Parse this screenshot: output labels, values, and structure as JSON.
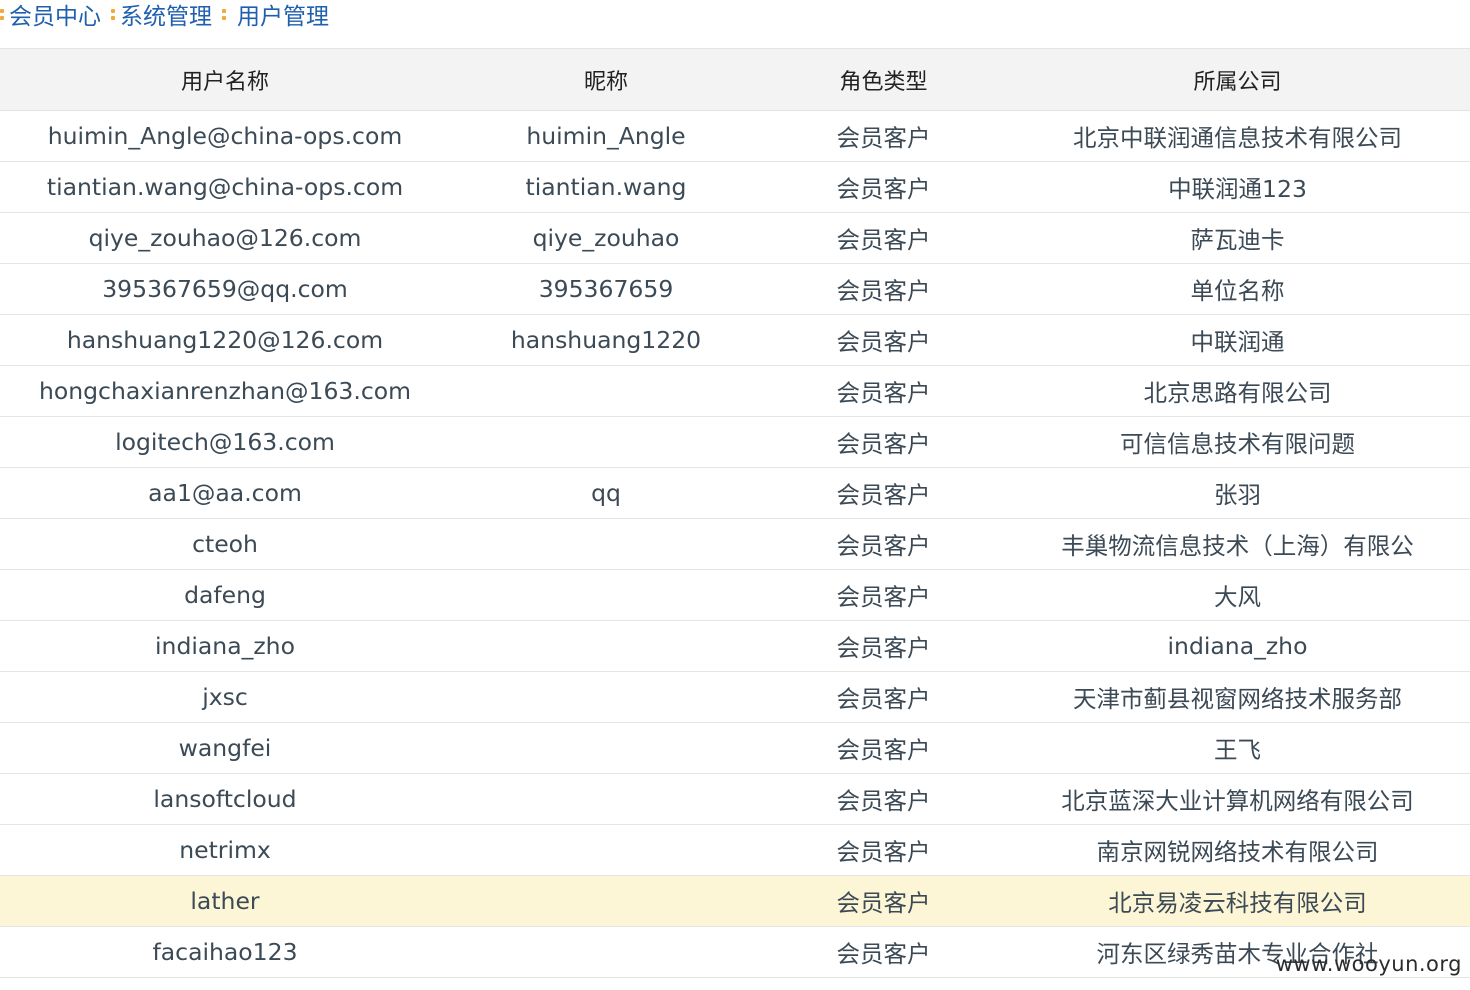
{
  "breadcrumb": [
    {
      "label": "会员中心"
    },
    {
      "label": "系统管理"
    },
    {
      "label": "用户管理"
    }
  ],
  "table": {
    "headers": [
      "用户名称",
      "昵称",
      "角色类型",
      "所属公司"
    ],
    "rows": [
      {
        "username": "huimin_Angle@china-ops.com",
        "nickname": "huimin_Angle",
        "role": "会员客户",
        "company": "北京中联润通信息技术有限公司"
      },
      {
        "username": "tiantian.wang@china-ops.com",
        "nickname": "tiantian.wang",
        "role": "会员客户",
        "company": "中联润通123"
      },
      {
        "username": "qiye_zouhao@126.com",
        "nickname": "qiye_zouhao",
        "role": "会员客户",
        "company": "萨瓦迪卡"
      },
      {
        "username": "395367659@qq.com",
        "nickname": "395367659",
        "role": "会员客户",
        "company": "单位名称"
      },
      {
        "username": "hanshuang1220@126.com",
        "nickname": "hanshuang1220",
        "role": "会员客户",
        "company": "中联润通"
      },
      {
        "username": "hongchaxianrenzhan@163.com",
        "nickname": "",
        "role": "会员客户",
        "company": "北京思路有限公司"
      },
      {
        "username": "logitech@163.com",
        "nickname": "",
        "role": "会员客户",
        "company": "可信信息技术有限问题"
      },
      {
        "username": "aa1@aa.com",
        "nickname": "qq",
        "role": "会员客户",
        "company": "张羽"
      },
      {
        "username": "cteoh",
        "nickname": "",
        "role": "会员客户",
        "company": "丰巢物流信息技术（上海）有限公"
      },
      {
        "username": "dafeng",
        "nickname": "",
        "role": "会员客户",
        "company": "大风"
      },
      {
        "username": "indiana_zho",
        "nickname": "",
        "role": "会员客户",
        "company": "indiana_zho"
      },
      {
        "username": "jxsc",
        "nickname": "",
        "role": "会员客户",
        "company": "天津市蓟县视窗网络技术服务部"
      },
      {
        "username": "wangfei",
        "nickname": "",
        "role": "会员客户",
        "company": "王飞"
      },
      {
        "username": "lansoftcloud",
        "nickname": "",
        "role": "会员客户",
        "company": "北京蓝深大业计算机网络有限公司"
      },
      {
        "username": "netrimx",
        "nickname": "",
        "role": "会员客户",
        "company": "南京网锐网络技术有限公司"
      },
      {
        "username": "lather",
        "nickname": "",
        "role": "会员客户",
        "company": "北京易凌云科技有限公司",
        "highlighted": true
      },
      {
        "username": "facaihao123",
        "nickname": "",
        "role": "会员客户",
        "company": "河东区绿秀苗木专业合作社"
      }
    ]
  },
  "watermark": "www.wooyun.org",
  "colors": {
    "link": "#1f5fae",
    "separator": "#f2a93b",
    "header_bg": "#f3f3f3",
    "highlight_bg": "#fdf6d6",
    "text": "#3c4a56"
  }
}
